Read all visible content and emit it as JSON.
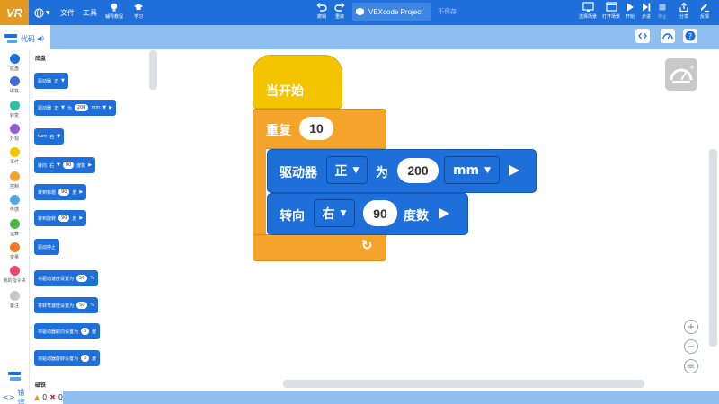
{
  "toolbar": {
    "logo": "VR",
    "file_menu": "文件",
    "tools_menu": "工具",
    "help_label": "辅导教程",
    "learn_label": "学习",
    "undo_label": "撤销",
    "redo_label": "重做",
    "project_name": "VEXcode Project",
    "save_status": "不保存",
    "select_scene_label": "选择场景",
    "open_scene_label": "打开场景",
    "start_label": "开始",
    "step_label": "步进",
    "stop_label": "停止",
    "share_label": "分享",
    "feedback_label": "反馈"
  },
  "code_tab": {
    "label": "代码"
  },
  "categories": [
    {
      "label": "底盘",
      "color": "#1e6fd9"
    },
    {
      "label": "磁铁",
      "color": "#3d6fd1"
    },
    {
      "label": "转变",
      "color": "#2bbf9c"
    },
    {
      "label": "外观",
      "color": "#9b59d6"
    },
    {
      "label": "事件",
      "color": "#f5c400"
    },
    {
      "label": "控制",
      "color": "#f4a42a"
    },
    {
      "label": "传感",
      "color": "#4fa8e8"
    },
    {
      "label": "运算",
      "color": "#4cb848"
    },
    {
      "label": "变量",
      "color": "#f07b2a"
    },
    {
      "label": "我的指令块",
      "color": "#e8466b"
    },
    {
      "label": "备注",
      "color": "#c8c8c8"
    }
  ],
  "palette": {
    "section_title": "底盘",
    "section_title_2": "磁铁",
    "blocks": [
      {
        "text": "驱动器",
        "arg1": "正",
        "extra": ""
      },
      {
        "text": "驱动器",
        "arg1": "正",
        "mid": "为",
        "num": "200",
        "unit": "mm"
      },
      {
        "text": "turn",
        "arg1": "右"
      },
      {
        "text": "转向",
        "arg1": "右",
        "num": "90",
        "unit": "度数"
      },
      {
        "text": "转到标题",
        "num": "90",
        "unit": "度"
      },
      {
        "text": "转到旋转",
        "num": "90",
        "unit": "度"
      },
      {
        "text": "驱动停止"
      },
      {
        "text": "将驱动速度设置为",
        "num": "50",
        "unit": "%"
      },
      {
        "text": "将转弯速度设置为",
        "num": "50",
        "unit": "%"
      },
      {
        "text": "将驱动器航向设置为",
        "num": "0",
        "unit": "度"
      },
      {
        "text": "将驱动器旋转设置为",
        "num": "0",
        "unit": "度"
      }
    ]
  },
  "workspace": {
    "hat_label": "当开始",
    "repeat_label": "重复",
    "repeat_count": "10",
    "drive_label": "驱动器",
    "drive_dir": "正",
    "drive_for": "为",
    "drive_distance": "200",
    "drive_unit": "mm",
    "turn_label": "转向",
    "turn_dir": "右",
    "turn_angle": "90",
    "turn_unit": "度数"
  },
  "status": {
    "errors_label": "错误",
    "warning_count": "0",
    "error_count": "0"
  }
}
